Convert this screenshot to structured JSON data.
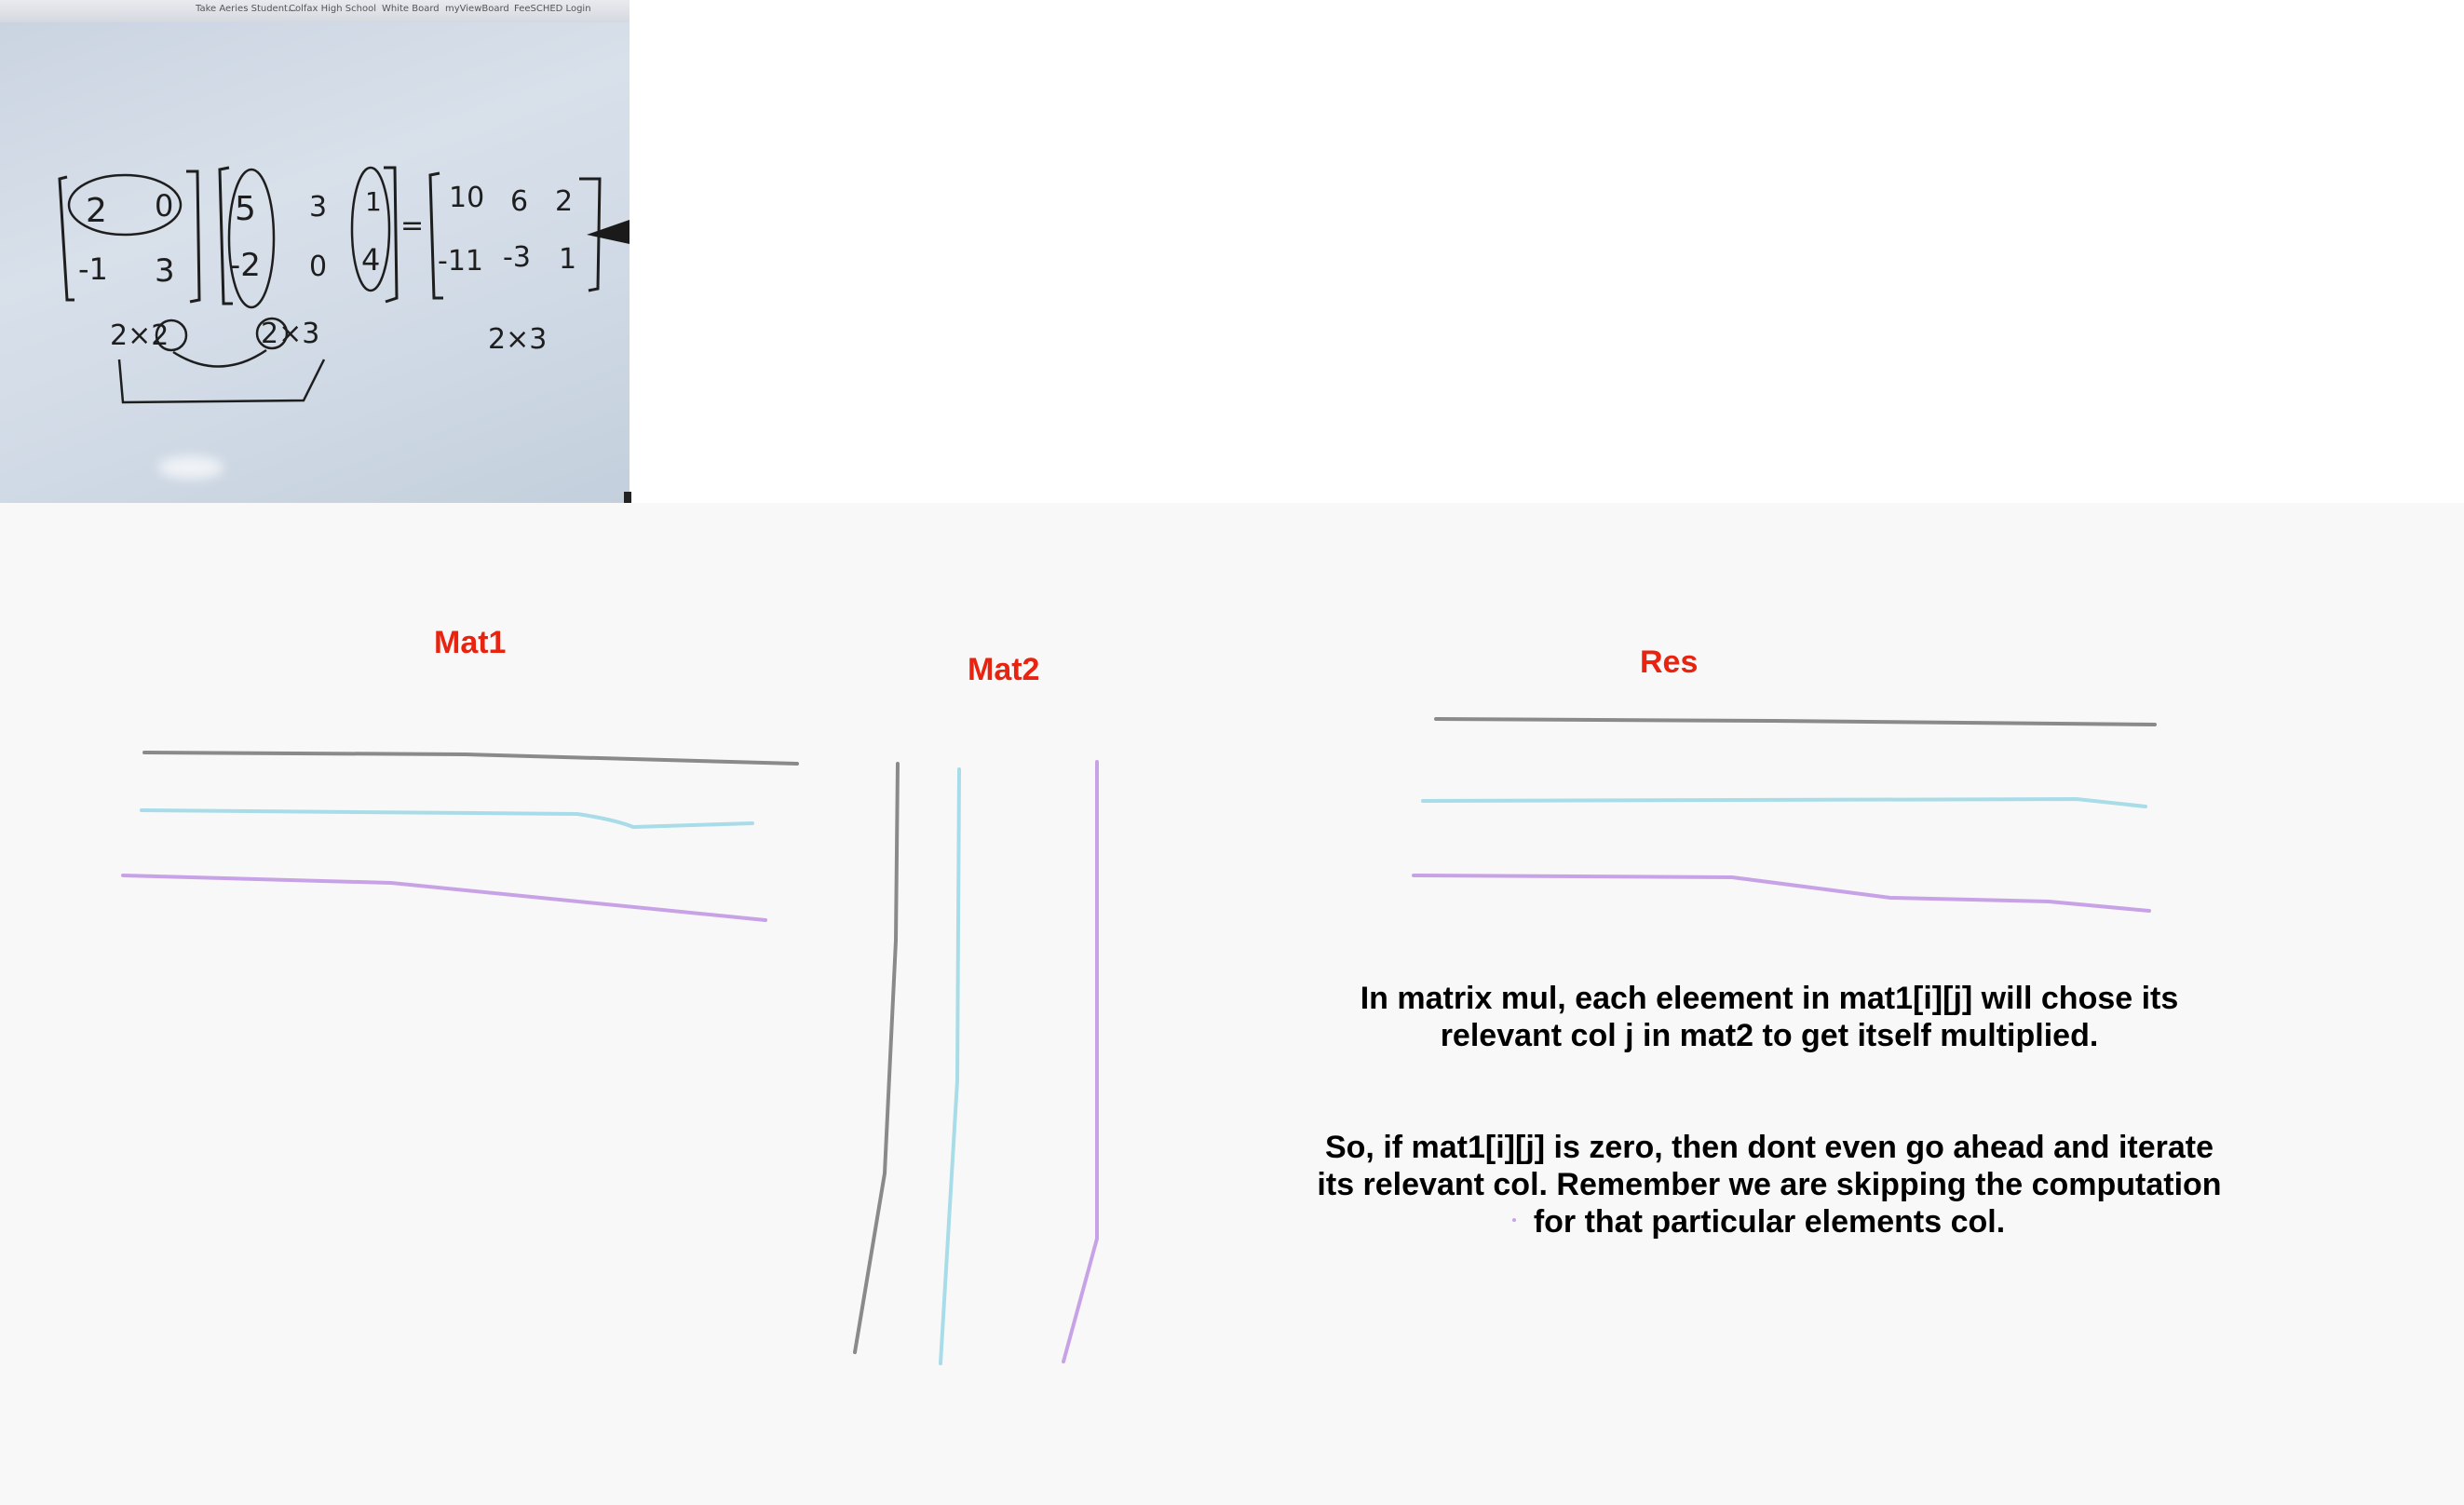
{
  "canvas": {
    "labels": {
      "mat1": "Mat1",
      "mat2": "Mat2",
      "res": "Res"
    },
    "note1": {
      "line1": "In matrix mul, each eleement in mat1[i][j] will chose its",
      "line2": "relevant col j in mat2 to get itself multiplied."
    },
    "note2": {
      "line1": "So, if mat1[i][j] is zero, then dont even go ahead and iterate",
      "line2": "its relevant col. Remember we are skipping the computation",
      "line3": "for that particular elements col."
    },
    "colors": {
      "label": "#e8230f",
      "row1_stroke": "#8a8a8a",
      "row2_stroke": "#a8dce8",
      "row3_stroke": "#c8a2e6"
    }
  },
  "whiteboard_photo": {
    "bookmarks": [
      "Take Aeries Student...",
      "Colfax High School",
      "White Board",
      "myViewBoard",
      "FeeSCHED Login"
    ],
    "matrix_a": [
      [
        "2",
        "0"
      ],
      [
        "-1",
        "3"
      ]
    ],
    "matrix_b": [
      [
        "5",
        "3",
        "1"
      ],
      [
        "-2",
        "0",
        "4"
      ]
    ],
    "matrix_result": [
      [
        "10",
        "6",
        "2"
      ],
      [
        "-11",
        "-3",
        "1"
      ]
    ],
    "dim_a": "2×2",
    "dim_b": "2×3",
    "dim_result": "2×3",
    "equals": "="
  }
}
